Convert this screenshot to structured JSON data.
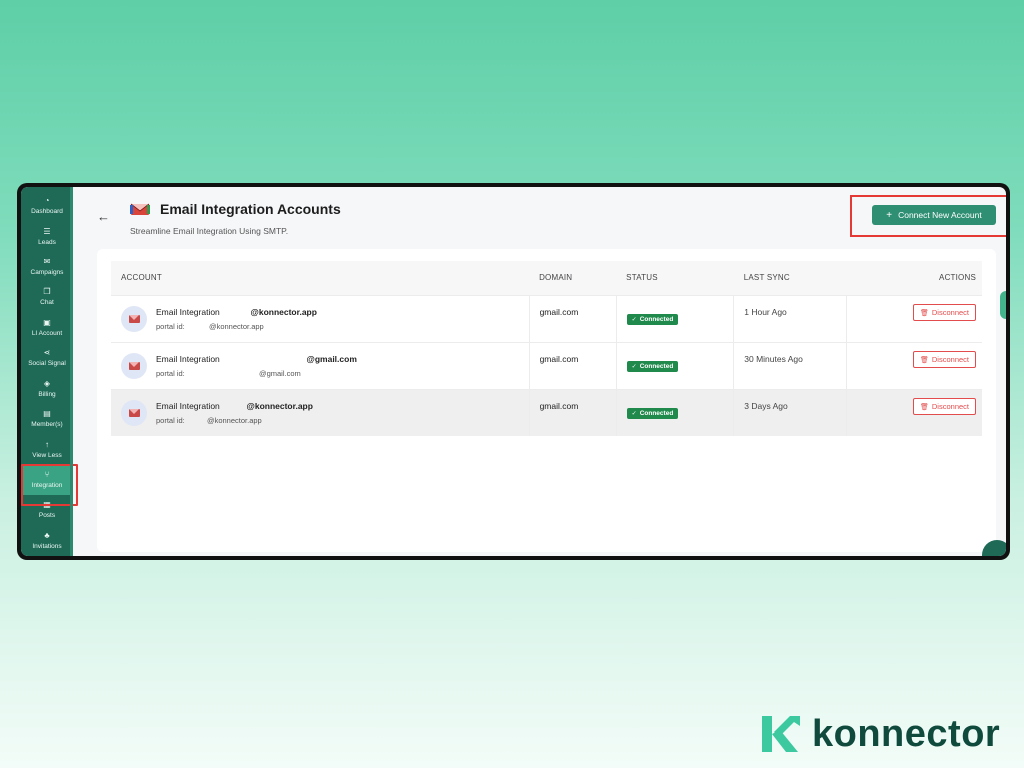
{
  "sidebar": {
    "items": [
      {
        "label": "Dashboard",
        "icon": "gauge-icon",
        "glyph": "◔"
      },
      {
        "label": "Leads",
        "icon": "list-icon",
        "glyph": "☰"
      },
      {
        "label": "Campaigns",
        "icon": "megaphone-icon",
        "glyph": "✉"
      },
      {
        "label": "Chat",
        "icon": "chat-icon",
        "glyph": "❐"
      },
      {
        "label": "LI Account",
        "icon": "account-icon",
        "glyph": "▣"
      },
      {
        "label": "Social Signal",
        "icon": "share-icon",
        "glyph": "⋖"
      },
      {
        "label": "Billing",
        "icon": "tag-icon",
        "glyph": "◈"
      },
      {
        "label": "Member(s)",
        "icon": "members-icon",
        "glyph": "▤"
      },
      {
        "label": "View Less",
        "icon": "arrow-up-icon",
        "glyph": "↑"
      },
      {
        "label": "Integration",
        "icon": "integration-icon",
        "glyph": "⑂"
      },
      {
        "label": "Posts",
        "icon": "posts-icon",
        "glyph": "▦"
      },
      {
        "label": "Invitations",
        "icon": "invitations-icon",
        "glyph": "♣"
      }
    ],
    "active_index": 9
  },
  "header": {
    "title": "Email Integration Accounts",
    "subtitle": "Streamline Email Integration Using SMTP.",
    "connect_label": "Connect New Account"
  },
  "table": {
    "columns": [
      "ACCOUNT",
      "DOMAIN",
      "STATUS",
      "LAST SYNC",
      "ACTIONS"
    ],
    "rows": [
      {
        "name_prefix": "Email Integration",
        "name_email": "@konnector.app",
        "portal_label": "portal id:",
        "portal_value": "@konnector.app",
        "domain": "gmail.com",
        "status": "Connected",
        "last_sync": "1 Hour Ago",
        "action": "Disconnect"
      },
      {
        "name_prefix": "Email Integration",
        "name_email": "@gmail.com",
        "portal_label": "portal id:",
        "portal_value": "@gmail.com",
        "domain": "gmail.com",
        "status": "Connected",
        "last_sync": "30 Minutes Ago",
        "action": "Disconnect"
      },
      {
        "name_prefix": "Email Integration",
        "name_email": "@konnector.app",
        "portal_label": "portal id:",
        "portal_value": "@konnector.app",
        "domain": "gmail.com",
        "status": "Connected",
        "last_sync": "3 Days Ago",
        "action": "Disconnect"
      }
    ]
  },
  "brand": {
    "name": "konnector",
    "accent": "#2f8f73",
    "highlight": "#e53935"
  }
}
